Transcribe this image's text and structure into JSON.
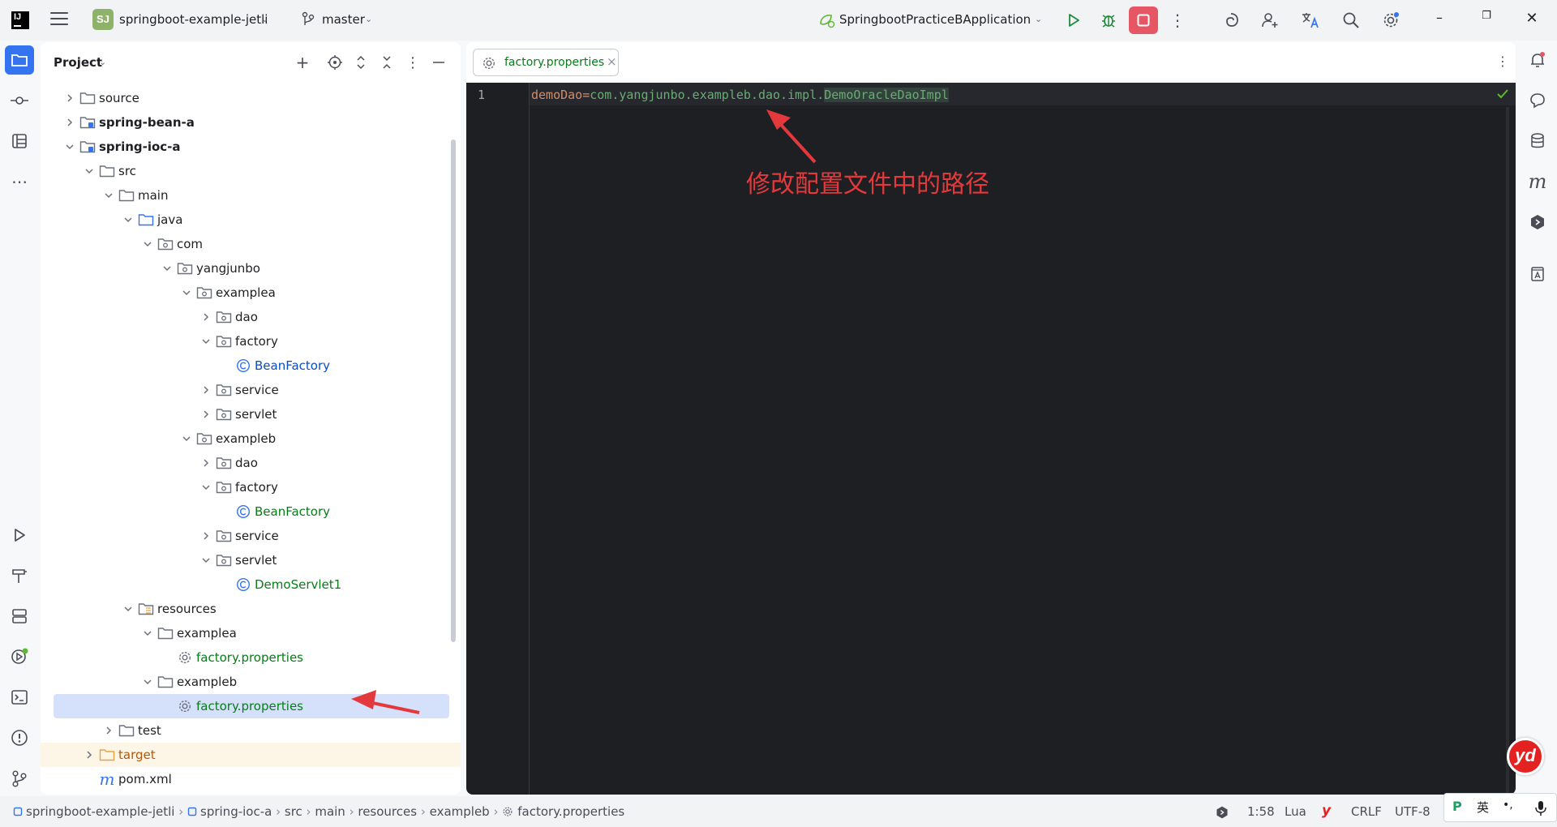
{
  "titlebar": {
    "project_initials": "SJ",
    "project_name": "springboot-example-jetli",
    "branch": "master",
    "run_config": "SpringbootPracticeBApplication"
  },
  "project_panel": {
    "title": "Project",
    "tree": [
      {
        "label": "source",
        "kind": "folder",
        "depth": 1,
        "expanded": false
      },
      {
        "label": "spring-bean-a",
        "kind": "module",
        "depth": 1,
        "expanded": false,
        "bold": true
      },
      {
        "label": "spring-ioc-a",
        "kind": "module",
        "depth": 1,
        "expanded": true,
        "bold": true
      },
      {
        "label": "src",
        "kind": "folder",
        "depth": 2,
        "expanded": true
      },
      {
        "label": "main",
        "kind": "folder",
        "depth": 3,
        "expanded": true
      },
      {
        "label": "java",
        "kind": "source-folder",
        "depth": 4,
        "expanded": true
      },
      {
        "label": "com",
        "kind": "package",
        "depth": 5,
        "expanded": true
      },
      {
        "label": "yangjunbo",
        "kind": "package",
        "depth": 6,
        "expanded": true
      },
      {
        "label": "examplea",
        "kind": "package",
        "depth": 7,
        "expanded": true
      },
      {
        "label": "dao",
        "kind": "package",
        "depth": 8,
        "expanded": false
      },
      {
        "label": "factory",
        "kind": "package",
        "depth": 8,
        "expanded": true
      },
      {
        "label": "BeanFactory",
        "kind": "class",
        "depth": 9,
        "color": "blue"
      },
      {
        "label": "service",
        "kind": "package",
        "depth": 8,
        "expanded": false
      },
      {
        "label": "servlet",
        "kind": "package",
        "depth": 8,
        "expanded": false
      },
      {
        "label": "exampleb",
        "kind": "package",
        "depth": 7,
        "expanded": true
      },
      {
        "label": "dao",
        "kind": "package",
        "depth": 8,
        "expanded": false
      },
      {
        "label": "factory",
        "kind": "package",
        "depth": 8,
        "expanded": true
      },
      {
        "label": "BeanFactory",
        "kind": "class",
        "depth": 9,
        "color": "green"
      },
      {
        "label": "service",
        "kind": "package",
        "depth": 8,
        "expanded": false
      },
      {
        "label": "servlet",
        "kind": "package",
        "depth": 8,
        "expanded": true
      },
      {
        "label": "DemoServlet1",
        "kind": "class",
        "depth": 9,
        "color": "green"
      },
      {
        "label": "resources",
        "kind": "resources-folder",
        "depth": 4,
        "expanded": true
      },
      {
        "label": "examplea",
        "kind": "folder",
        "depth": 5,
        "expanded": true
      },
      {
        "label": "factory.properties",
        "kind": "properties",
        "depth": 6,
        "color": "green"
      },
      {
        "label": "exampleb",
        "kind": "folder",
        "depth": 5,
        "expanded": true
      },
      {
        "label": "factory.properties",
        "kind": "properties",
        "depth": 6,
        "color": "green",
        "selected": true
      },
      {
        "label": "test",
        "kind": "folder",
        "depth": 3,
        "expanded": false
      },
      {
        "label": "target",
        "kind": "excluded-folder",
        "depth": 2,
        "expanded": false,
        "color": "orange"
      },
      {
        "label": "pom.xml",
        "kind": "maven",
        "depth": 2
      }
    ]
  },
  "editor": {
    "tab_label": "factory.properties",
    "line_number": "1",
    "code_key": "demoDao",
    "code_eq": "=",
    "code_value_plain": "com.yangjunbo.exampleb.dao.impl.",
    "code_value_highlight": "DemoOracleDaoImpl",
    "annotation": "修改配置文件中的路径"
  },
  "statusbar": {
    "breadcrumbs": [
      "springboot-example-jetli",
      "spring-ioc-a",
      "src",
      "main",
      "resources",
      "exampleb",
      "factory.properties"
    ],
    "position": "1:58",
    "language": "Lua",
    "line_ending": "CRLF",
    "encoding": "UTF-8",
    "ime_lang": "英",
    "ime_punct": "•,"
  },
  "colors": {
    "accent": "#3574f0",
    "stop": "#e55765",
    "annotation": "#e4393c",
    "editor_bg": "#1e1f22"
  }
}
